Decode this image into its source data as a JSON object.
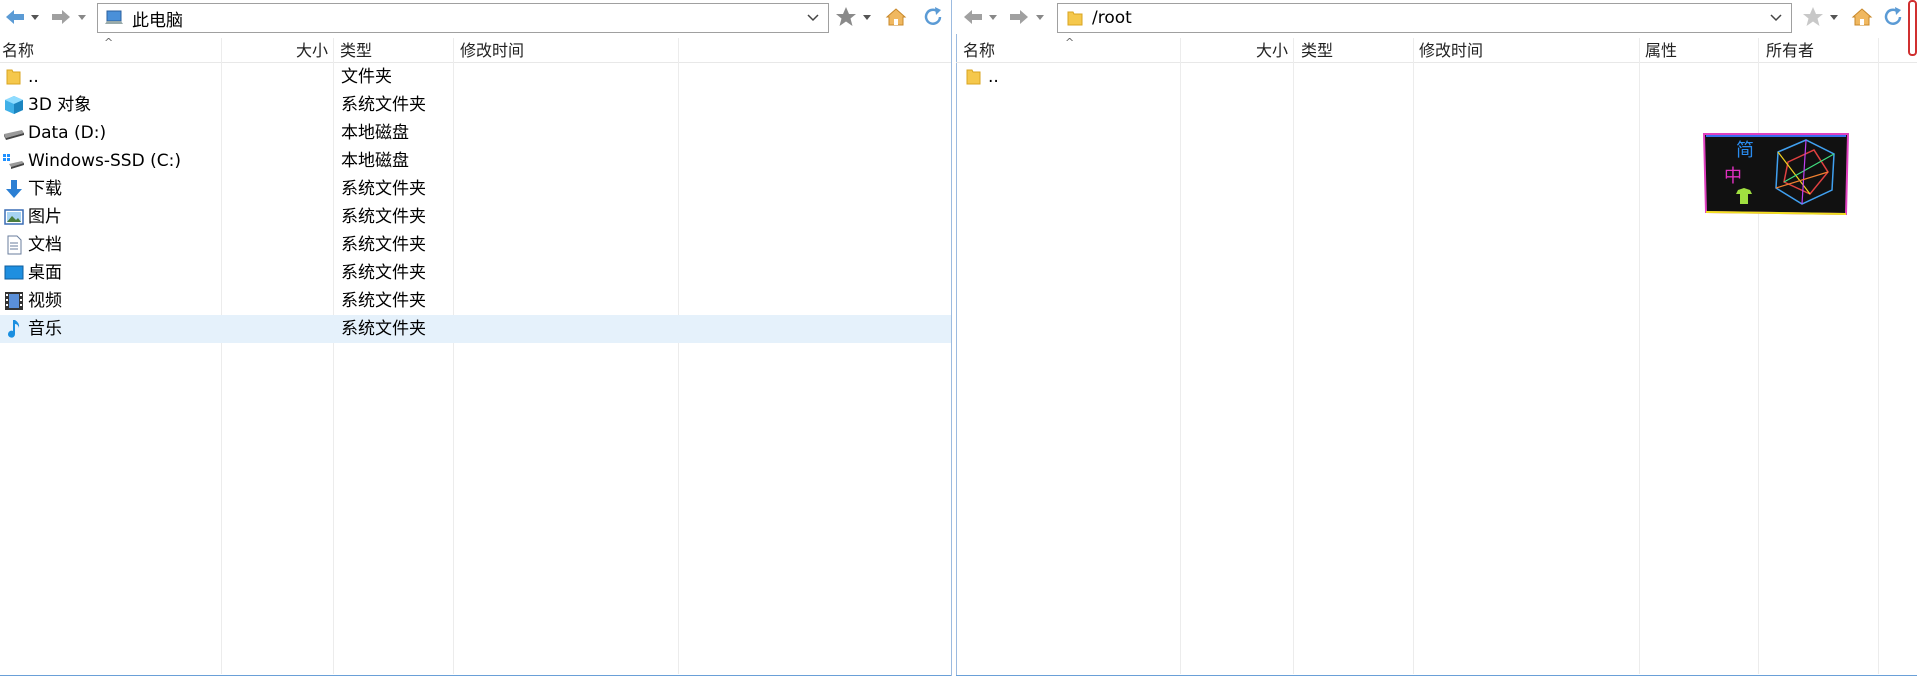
{
  "left": {
    "path": "此电脑",
    "columns": {
      "name": "名称",
      "size": "大小",
      "type": "类型",
      "modified": "修改时间"
    },
    "rows": [
      {
        "name": "..",
        "size": "",
        "type": "文件夹",
        "modified": "",
        "icon": "folder-icon"
      },
      {
        "name": "3D 对象",
        "size": "",
        "type": "系统文件夹",
        "modified": "",
        "icon": "3d-objects-icon"
      },
      {
        "name": "Data (D:)",
        "size": "",
        "type": "本地磁盘",
        "modified": "",
        "icon": "drive-icon"
      },
      {
        "name": "Windows-SSD (C:)",
        "size": "",
        "type": "本地磁盘",
        "modified": "",
        "icon": "system-drive-icon"
      },
      {
        "name": "下载",
        "size": "",
        "type": "系统文件夹",
        "modified": "",
        "icon": "download-icon"
      },
      {
        "name": "图片",
        "size": "",
        "type": "系统文件夹",
        "modified": "",
        "icon": "pictures-icon"
      },
      {
        "name": "文档",
        "size": "",
        "type": "系统文件夹",
        "modified": "",
        "icon": "documents-icon"
      },
      {
        "name": "桌面",
        "size": "",
        "type": "系统文件夹",
        "modified": "",
        "icon": "desktop-icon"
      },
      {
        "name": "视频",
        "size": "",
        "type": "系统文件夹",
        "modified": "",
        "icon": "videos-icon"
      },
      {
        "name": "音乐",
        "size": "",
        "type": "系统文件夹",
        "modified": "",
        "icon": "music-icon",
        "selected": true
      }
    ]
  },
  "right": {
    "path": "/root",
    "columns": {
      "name": "名称",
      "size": "大小",
      "type": "类型",
      "modified": "修改时间",
      "attributes": "属性",
      "owner": "所有者"
    },
    "rows": [
      {
        "name": "..",
        "size": "",
        "type": "",
        "modified": "",
        "attributes": "",
        "owner": "",
        "icon": "folder-icon"
      }
    ]
  },
  "sticker": {
    "char_top": "简",
    "char_mid": "中"
  },
  "colors": {
    "accent": "#6aa0d8",
    "selection": "#e5f1fb",
    "folder": "#f5c84c",
    "nav_arrow": "#5b9bd5"
  }
}
